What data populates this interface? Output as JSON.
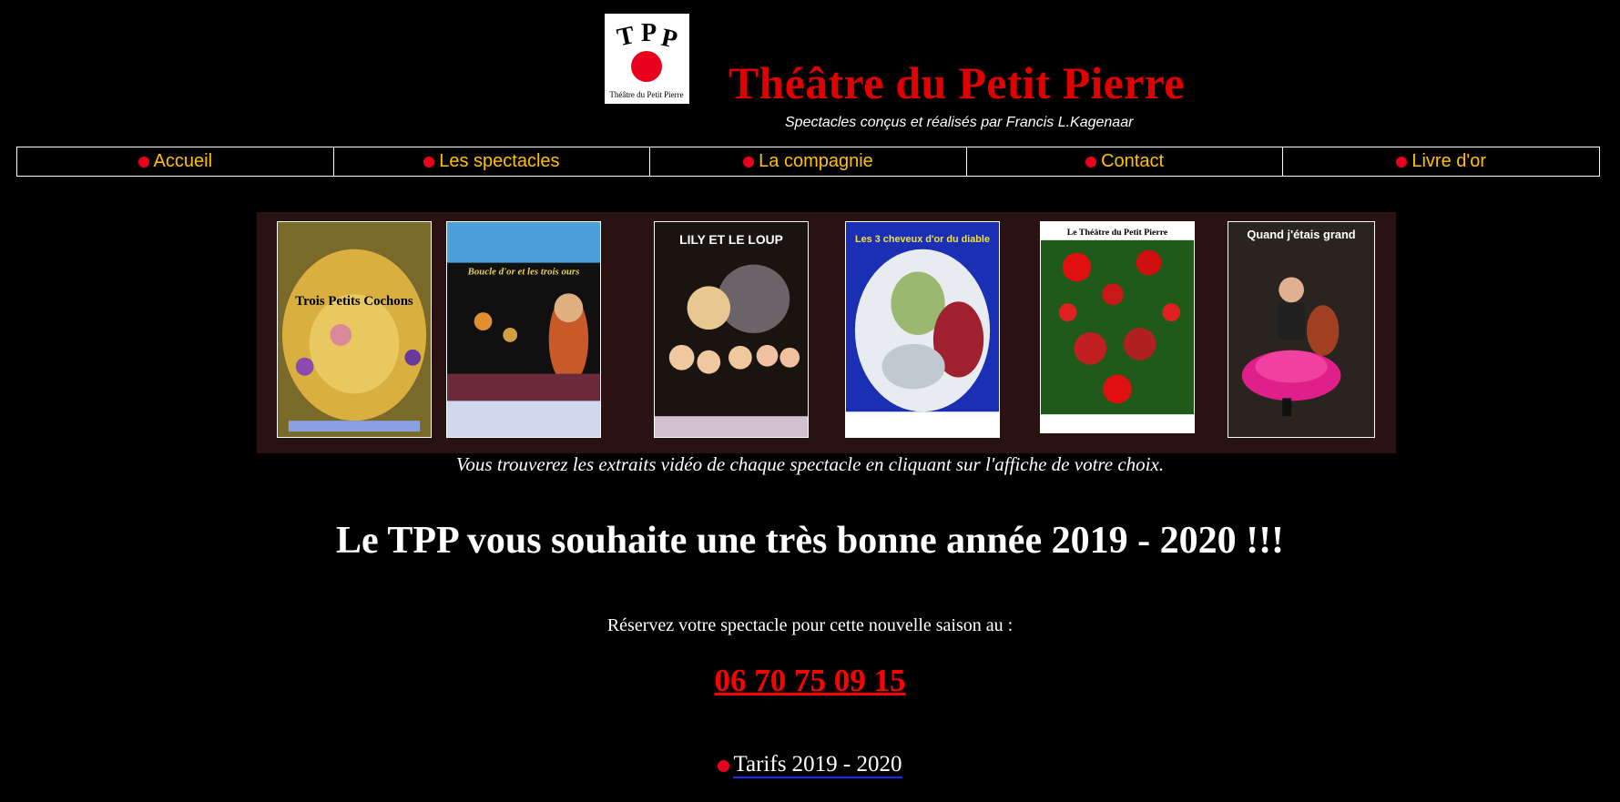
{
  "header": {
    "logo_letters": [
      "T",
      "P",
      "P"
    ],
    "logo_caption": "Théâtre du Petit Pierre",
    "title": "Théâtre du Petit Pierre",
    "subtitle": "Spectacles conçus et réalisés par Francis L.Kagenaar"
  },
  "nav": {
    "items": [
      {
        "label": "Accueil"
      },
      {
        "label": "Les spectacles"
      },
      {
        "label": "La compagnie"
      },
      {
        "label": "Contact"
      },
      {
        "label": "Livre d'or"
      }
    ]
  },
  "posters": [
    {
      "title": "Trois Petits Cochons",
      "color": "#c9a23a"
    },
    {
      "title": "Boucle d'or et les trois ours",
      "color": "#5a2a6a"
    },
    {
      "title": "LILY ET LE LOUP",
      "color": "#1a1410"
    },
    {
      "title": "Les 3 cheveux d'or du diable",
      "color": "#1b2fb5"
    },
    {
      "title": "Le Théâtre du Petit Pierre",
      "color": "#1f5a1a"
    },
    {
      "title": "Quand j'étais grand",
      "color": "#3a2a24"
    }
  ],
  "main": {
    "note": "Vous trouverez les extraits vidéo de chaque spectacle en cliquant sur l'affiche de votre choix.",
    "greeting": "Le TPP vous souhaite une très bonne année 2019 - 2020 !!!",
    "reserve_text": "Réservez votre spectacle pour cette nouvelle saison au :",
    "phone": "06 70 75 09 15",
    "tarifs_link": "Tarifs 2019 - 2020"
  },
  "colors": {
    "accent_red": "#e00000",
    "nav_text": "#ffc000",
    "dot": "#e8001c"
  }
}
